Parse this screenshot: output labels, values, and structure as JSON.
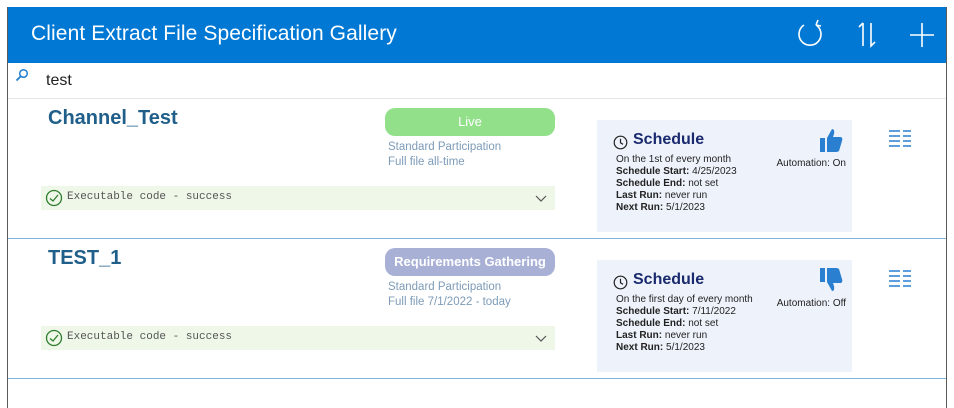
{
  "header": {
    "title": "Client Extract File Specification Gallery",
    "icons": [
      "refresh-icon",
      "sort-icon",
      "add-icon"
    ],
    "bg_color": "#0078d4"
  },
  "search": {
    "value": "test",
    "icon": "search-icon"
  },
  "cards": [
    {
      "title": "Channel_Test",
      "status": "Live",
      "status_color": "#92e08a",
      "participation": "Standard Participation",
      "file_range": "Full file all-time",
      "exec_status": "Executable code - success",
      "schedule": {
        "title": "Schedule",
        "frequency": "On the 1st of every month",
        "start_label": "Schedule Start:",
        "start_value": "4/25/2023",
        "end_label": "Schedule End:",
        "end_value": "not set",
        "last_label": "Last Run:",
        "last_value": "never run",
        "next_label": "Next Run:",
        "next_value": "5/1/2023",
        "automation": "Automation: On",
        "thumb": "thumbs-up-icon"
      }
    },
    {
      "title": "TEST_1",
      "status": "Requirements Gathering",
      "status_color": "#a8b0d6",
      "participation": "Standard Participation",
      "file_range": "Full file 7/1/2022 - today",
      "exec_status": "Executable code - success",
      "schedule": {
        "title": "Schedule",
        "frequency": "On the first day of every month",
        "start_label": "Schedule Start:",
        "start_value": "7/11/2022",
        "end_label": "Schedule End:",
        "end_value": "not set",
        "last_label": "Last Run:",
        "last_value": "never run",
        "next_label": "Next Run:",
        "next_value": "5/1/2023",
        "automation": "Automation: Off",
        "thumb": "thumbs-down-icon"
      }
    }
  ]
}
